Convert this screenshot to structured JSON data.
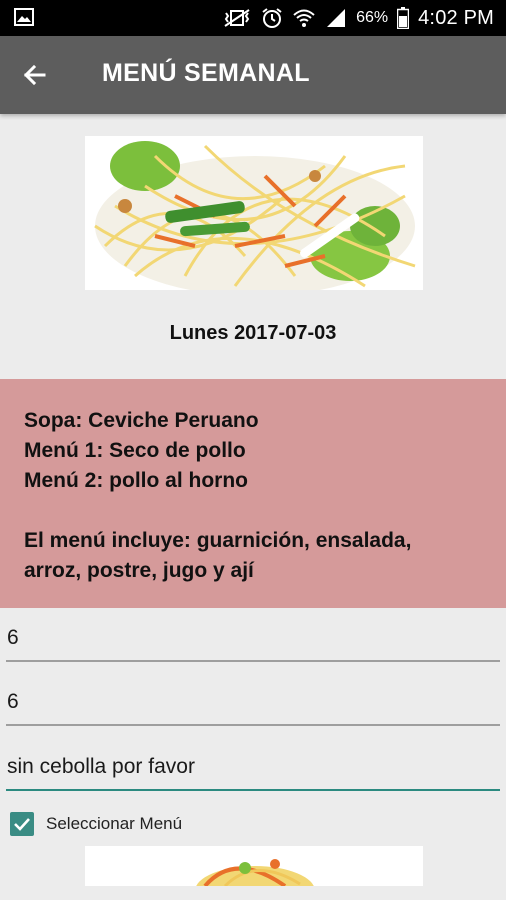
{
  "status_bar": {
    "battery_percent": "66%",
    "time": "4:02 PM",
    "icons": [
      "gallery-icon",
      "vibrate-mute-icon",
      "alarm-icon",
      "wifi-icon",
      "signal-icon",
      "battery-icon"
    ]
  },
  "toolbar": {
    "title": "MENÚ SEMANAL",
    "back_icon": "arrow-left-icon"
  },
  "day": {
    "date_label": "Lunes 2017-07-03",
    "menu_lines": [
      "Sopa: Ceviche Peruano",
      "Menú 1: Seco de pollo",
      "Menú 2: pollo al horno"
    ],
    "includes_lines": [
      "El menú incluye: guarnición, ensalada,",
      "arroz, postre, jugo y ají"
    ],
    "menu_box_color": "#d59a9a"
  },
  "form": {
    "field1_value": "6",
    "field2_value": "6",
    "notes_value": "sin cebolla por favor",
    "select_label": "Seleccionar Menú",
    "select_checked": true
  },
  "colors": {
    "toolbar": "#5d5d5d",
    "accent": "#3a8c84",
    "background": "#ececec"
  }
}
